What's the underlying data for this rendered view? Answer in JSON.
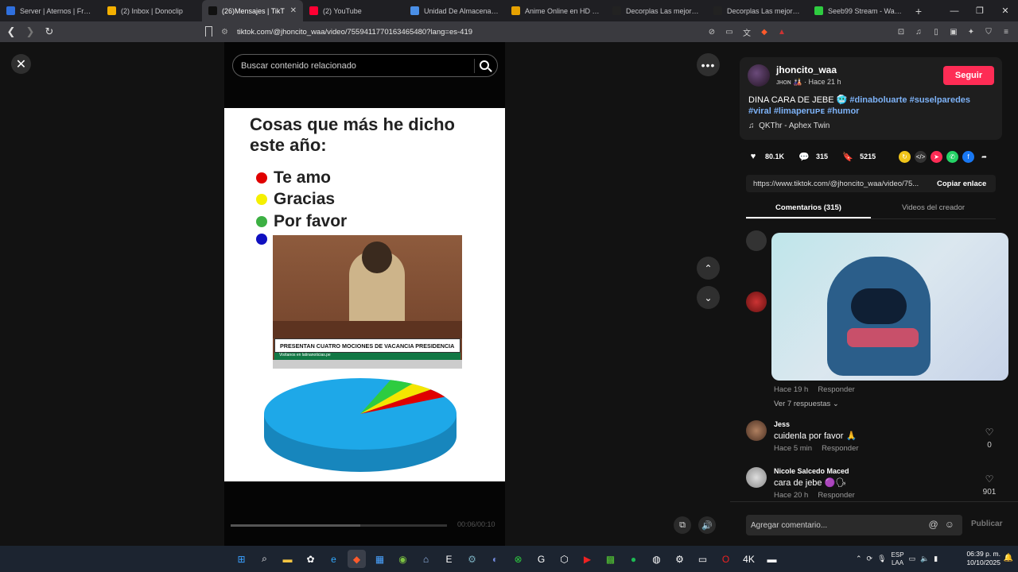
{
  "browser": {
    "tabs": [
      {
        "title": "Server | Aternos | Free Min",
        "color": "#2f6fdd",
        "active": false
      },
      {
        "title": "(2) Inbox | Donoclip",
        "color": "#f4b000",
        "active": false
      },
      {
        "title": "(26)Mensajes | TikT",
        "color": "#111111",
        "active": true
      },
      {
        "title": "(2) YouTube",
        "color": "#ff0033",
        "active": false
      },
      {
        "title": "Unidad De Almacenamien",
        "color": "#4a8fe7",
        "active": false
      },
      {
        "title": "Anime Online en HD - Tio",
        "color": "#e6a100",
        "active": false
      },
      {
        "title": "Decorplas Las mejores Of",
        "color": "#222222",
        "active": false
      },
      {
        "title": "Decorplas Las mejores Of",
        "color": "#222222",
        "active": false
      },
      {
        "title": "Seeb99 Stream - Watch Li",
        "color": "#2ecc40",
        "active": false
      }
    ],
    "url": "tiktok.com/@jhoncito_waa/video/7559411770163465480?lang=es-419"
  },
  "video": {
    "search_placeholder": "Buscar contenido relacionado",
    "frame_title": "Cosas que más he dicho este año:",
    "legend": [
      {
        "label": "Te amo",
        "color": "#e00000"
      },
      {
        "label": "Gracias",
        "color": "#f5f000"
      },
      {
        "label": "Por favor",
        "color": "#3cb043"
      },
      {
        "label": "",
        "color": "#1010c0"
      }
    ],
    "inset_banner": "PRESENTAN CUATRO MOCIONES DE VACANCIA PRESIDENCIA",
    "inset_subbanner": "Visítanos en latinanoticias.pe",
    "timecode": "00:06/00:10",
    "progress": 0.6
  },
  "chart_data": {
    "type": "pie",
    "categories": [
      "Blue",
      "Green",
      "Yellow",
      "Red"
    ],
    "values": [
      88,
      4,
      4,
      4
    ],
    "colors": [
      "#1ea8e8",
      "#2ecc40",
      "#f5e600",
      "#e00000"
    ]
  },
  "post": {
    "username": "jhoncito_waa",
    "display": "ᴊʜᴏɴ 🎎 · Hace 21 h",
    "follow_label": "Seguir",
    "desc_text": "DINA CARA DE JEBE 🥶",
    "hashtags": [
      "#dinaboluarte",
      "#suselparedes",
      "#viral",
      "#limaperuᴘᴇ",
      "#humor"
    ],
    "music": "QKThr - Aphex Twin",
    "likes": "80.1K",
    "comments": "315",
    "saves": "5215",
    "link": "https://www.tiktok.com/@jhoncito_waa/video/75...",
    "copy_label": "Copiar enlace",
    "tab_comments": "Comentarios (315)",
    "tab_creator": "Videos del creador"
  },
  "comments": [
    {
      "name": "",
      "text": "",
      "time": "Hace 19 h",
      "reply": "Responder",
      "likes": ""
    },
    {
      "view_replies": "Ver 7 respuestas ⌄"
    },
    {
      "name": "Jess",
      "text": "cuidenla por favor 🙏",
      "time": "Hace 5 min",
      "reply": "Responder",
      "likes": "0"
    },
    {
      "name": "Nicole Salcedo Maced",
      "text": "cara de jebe 🟣🗣",
      "time": "Hace 20 h",
      "reply": "Responder",
      "likes": "901"
    }
  ],
  "composer": {
    "placeholder": "Agregar comentario...",
    "post_label": "Publicar"
  },
  "taskbar": {
    "lang_top": "ESP",
    "lang_bottom": "LAA",
    "time": "06:39 p. m.",
    "date": "10/10/2025"
  }
}
